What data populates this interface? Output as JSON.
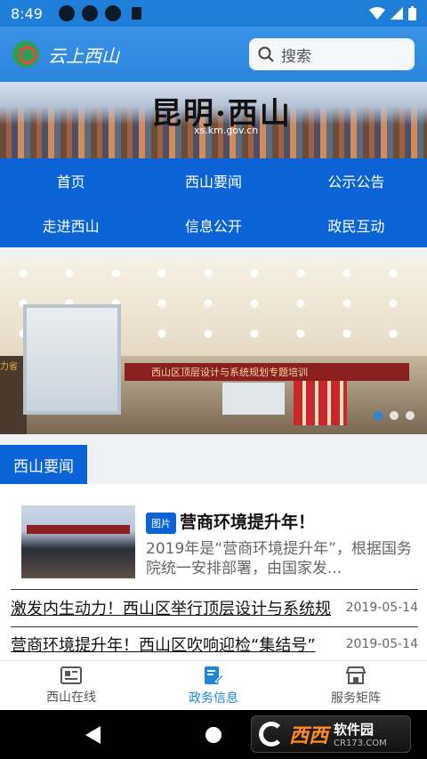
{
  "status_bar": {
    "time": "8:49"
  },
  "header": {
    "logo_text": "云上西山",
    "search_placeholder": "搜索"
  },
  "banner": {
    "title": "昆明·西山",
    "url": "xs.km.gov.cn"
  },
  "nav": {
    "items": [
      {
        "label": "首页"
      },
      {
        "label": "西山要闻"
      },
      {
        "label": "公示公告"
      },
      {
        "label": "走进西山"
      },
      {
        "label": "信息公开"
      },
      {
        "label": "政民互动"
      }
    ]
  },
  "carousel": {
    "banner_text": "西山区顶层设计与系统规划专题培训",
    "wall_text": "力省",
    "slide_count": 3,
    "active_index": 0
  },
  "section": {
    "title": "西山要闻"
  },
  "feature": {
    "badge": "图片",
    "title": "营商环境提升年！",
    "summary": "2019年是“营商环境提升年”，根据国务院统一安排部署，由国家发..."
  },
  "news": [
    {
      "title": "激发内生动力！西山区举行顶层设计与系统规",
      "date": "2019-05-14"
    },
    {
      "title": "营商环境提升年！西山区吹响迎检“集结号”",
      "date": "2019-05-14"
    }
  ],
  "tabbar": {
    "items": [
      {
        "label": "西山在线",
        "icon": "newspaper-icon"
      },
      {
        "label": "政务信息",
        "icon": "document-edit-icon",
        "active": true
      },
      {
        "label": "服务矩阵",
        "icon": "store-icon"
      }
    ]
  },
  "watermark": {
    "brand": "西西",
    "name": "软件园",
    "domain": "CR173.COM"
  },
  "colors": {
    "primary": "#0b63d6",
    "header": "#2c86dc",
    "active_tab": "#1e86d8"
  }
}
